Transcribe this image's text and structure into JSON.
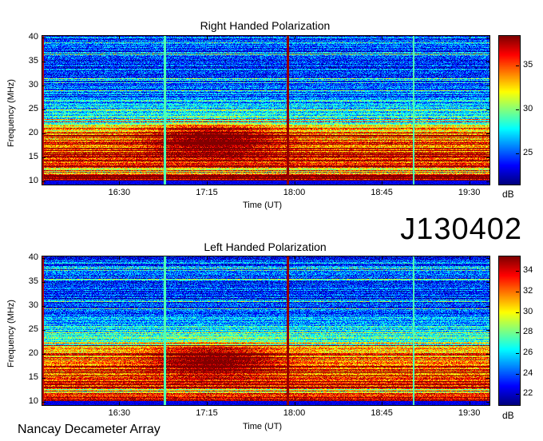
{
  "domain": "Chart",
  "observation_id": "J130402",
  "footer_label": "Nancay Decameter Array",
  "colors": {
    "colormap": "jet",
    "low": "#00008f",
    "high": "#800000"
  },
  "chart_data": [
    {
      "type": "heatmap",
      "title": "Right Handed Polarization",
      "xlabel": "Time (UT)",
      "ylabel": "Frequency (MHz)",
      "x_ticks": [
        "16:30",
        "17:15",
        "18:00",
        "18:45",
        "19:30"
      ],
      "x_range": [
        "15:50",
        "19:40"
      ],
      "y_ticks": [
        10,
        15,
        20,
        25,
        30,
        35,
        40
      ],
      "ylim": [
        9.5,
        40.5
      ],
      "colorbar_label": "dB",
      "colorbar_ticks": [
        25,
        30,
        35
      ],
      "colorbar_range": [
        21.5,
        38.5
      ]
    },
    {
      "type": "heatmap",
      "title": "Left Handed Polarization",
      "xlabel": "Time (UT)",
      "ylabel": "Frequency (MHz)",
      "x_ticks": [
        "16:30",
        "17:15",
        "18:00",
        "18:45",
        "19:30"
      ],
      "x_range": [
        "15:50",
        "19:40"
      ],
      "y_ticks": [
        10,
        15,
        20,
        25,
        30,
        35,
        40
      ],
      "ylim": [
        9.5,
        40.5
      ],
      "colorbar_label": "dB",
      "colorbar_ticks": [
        22,
        24,
        26,
        28,
        30,
        32,
        34
      ],
      "colorbar_range": [
        21,
        35.5
      ]
    }
  ]
}
